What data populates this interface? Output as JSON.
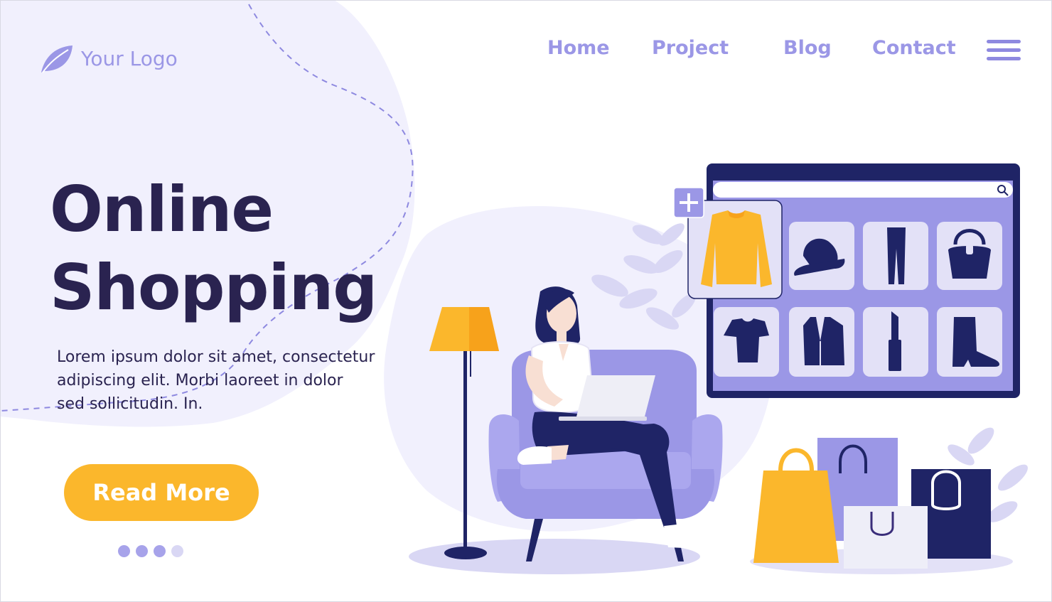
{
  "logo": {
    "text": "Your Logo",
    "icon": "leaf-icon"
  },
  "nav": {
    "items": [
      {
        "label": "Home"
      },
      {
        "label": "Project"
      },
      {
        "label": "Blog"
      },
      {
        "label": "Contact"
      }
    ],
    "menu_icon": "hamburger-menu-icon"
  },
  "hero": {
    "title_line1": "Online",
    "title_line2": "Shopping",
    "description_line1": "Lorem ipsum dolor sit amet, consectetur",
    "description_line2": "adipiscing elit. Morbi laoreet in dolor",
    "description_line3": "sed sollicitudin. In.",
    "cta_label": "Read More",
    "slides": {
      "count": 4,
      "active": 1
    }
  },
  "store_window": {
    "search_icon": "search-icon",
    "add_icon": "plus-icon",
    "products": [
      {
        "name": "sweater-icon"
      },
      {
        "name": "cap-icon"
      },
      {
        "name": "pants-icon"
      },
      {
        "name": "handbag-icon"
      },
      {
        "name": "tshirt-icon"
      },
      {
        "name": "blazer-icon"
      },
      {
        "name": "lipstick-icon"
      },
      {
        "name": "boot-icon"
      }
    ]
  },
  "colors": {
    "primary": "#9b97e6",
    "dark": "#2a2350",
    "navy": "#1f2466",
    "accent": "#fbb72c",
    "light_bg": "#f1f0fd"
  }
}
